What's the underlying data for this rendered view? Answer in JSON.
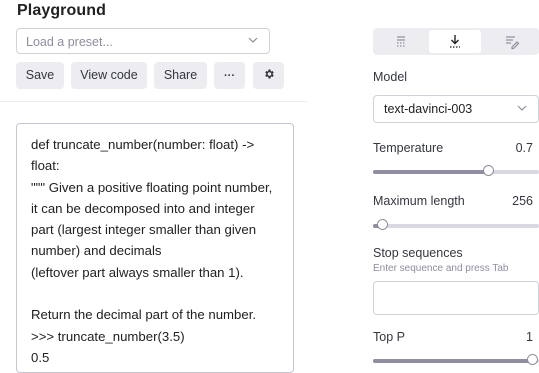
{
  "title": "Playground",
  "preset": {
    "placeholder": "Load a preset...",
    "icon": "chevron-down-icon"
  },
  "toolbar": {
    "save": "Save",
    "view_code": "View code",
    "share": "Share",
    "more": "···",
    "settings_icon": "gear-icon"
  },
  "editor": {
    "text": "def truncate_number(number: float) -> float:\n\"\"\" Given a positive floating point number, it can be decomposed into and integer part (largest integer smaller than given number) and decimals\n(leftover part always smaller than 1).\n\nReturn the decimal part of the number.\n>>> truncate_number(3.5)\n0.5"
  },
  "modes": {
    "icons": [
      "complete-mode-icon",
      "insert-mode-icon",
      "edit-mode-icon"
    ],
    "selected": "insert"
  },
  "settings": {
    "model_label": "Model",
    "model_value": "text-davinci-003",
    "temperature_label": "Temperature",
    "temperature_value": "0.7",
    "temperature_fraction": 0.7,
    "max_length_label": "Maximum length",
    "max_length_value": "256",
    "max_length_fraction": 0.062,
    "stop_label": "Stop sequences",
    "stop_hint": "Enter sequence and press Tab",
    "top_p_label": "Top P",
    "top_p_value": "1",
    "top_p_fraction": 1.0
  },
  "colors": {
    "accent": "#10a37f",
    "button_bg": "#ececf1",
    "border": "#cfd2d8"
  }
}
